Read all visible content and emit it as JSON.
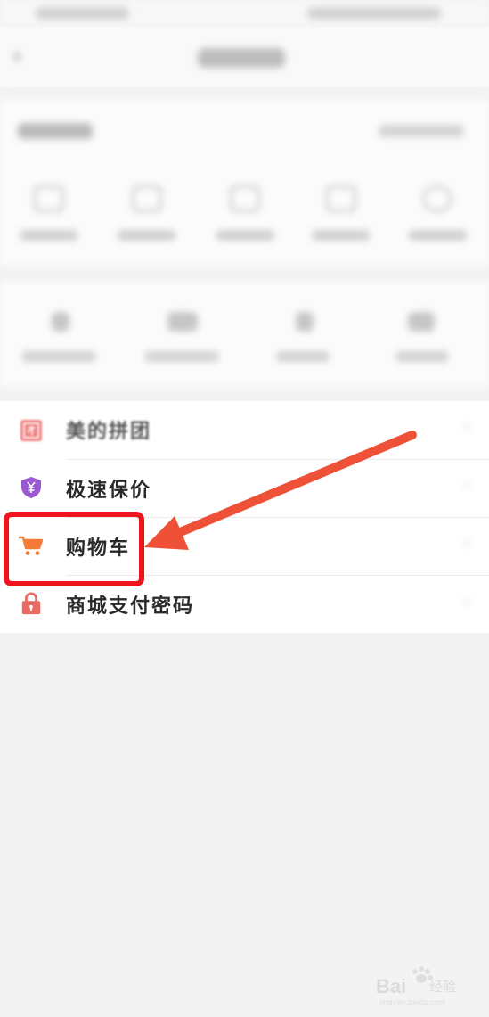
{
  "menu": {
    "items": [
      {
        "label": "美的拼团",
        "icon": "group-buy-icon",
        "color": "#ec5b5b"
      },
      {
        "label": "极速保价",
        "icon": "yuan-shield-icon",
        "color": "#9b59d0"
      },
      {
        "label": "购物车",
        "icon": "shopping-cart-icon",
        "color": "#f47a35"
      },
      {
        "label": "商城支付密码",
        "icon": "lock-icon",
        "color": "#e96b63"
      }
    ]
  },
  "colors": {
    "highlight": "#f0141c",
    "arrow": "#ee5138",
    "background": "#f3f3f3"
  },
  "watermark": {
    "brand": "Bai",
    "brand_suffix": "经验",
    "domain": "jingyan.baidu.com"
  }
}
